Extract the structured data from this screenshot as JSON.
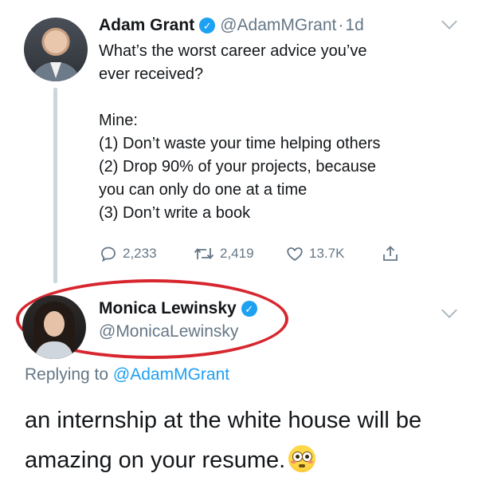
{
  "tweet1": {
    "author_name": "Adam Grant",
    "handle": "@AdamMGrant",
    "separator": "·",
    "time_ago": "1d",
    "text_lines": [
      "What’s the worst career advice you’ve",
      "ever received?",
      "",
      "Mine:",
      "(1) Don’t waste your time helping others",
      "(2) Drop 90% of your projects, because",
      "you can only do one at a time",
      "(3) Don’t write a book"
    ],
    "stats": {
      "replies": "2,233",
      "retweets": "2,419",
      "likes": "13.7K"
    }
  },
  "tweet2": {
    "author_name": "Monica Lewinsky",
    "handle": "@MonicaLewinsky",
    "replying_to_prefix": "Replying to",
    "replying_to_handle": "@AdamMGrant",
    "text_lines": [
      "an internship at the white house will be",
      "amazing on your resume."
    ],
    "emoji_icon": "flushed-face-emoji"
  },
  "colors": {
    "accent_blue": "#1da1f2",
    "muted_gray": "#657786",
    "highlight_red": "#d7262e",
    "thread_line": "#ccd6dd"
  },
  "icons": {
    "verified": "verified-badge-icon",
    "menu": "chevron-down-icon",
    "reply": "reply-icon",
    "retweet": "retweet-icon",
    "like": "heart-icon",
    "share": "share-icon"
  }
}
